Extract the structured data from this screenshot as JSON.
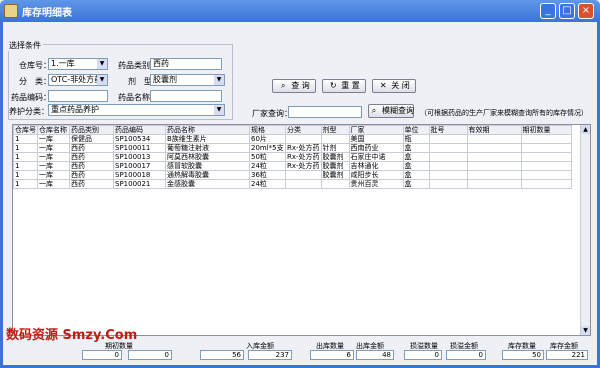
{
  "window": {
    "title": "库存明细表",
    "minimize": "_",
    "maximize": "□",
    "close": "×"
  },
  "filters": {
    "group_label": "选择条件",
    "warehouse_label": "仓库号：",
    "warehouse_value": "1.一库",
    "category_label": "药品类别：",
    "category_value": "西药",
    "type_label": "分　类：",
    "type_value": "OTC-非处方药",
    "form_label": "剂　型：",
    "form_value": "胶囊剂",
    "code_label": "药品编码：",
    "code_value": "",
    "name_label": "药品名称：",
    "name_value": "",
    "care_label": "养护分类：",
    "care_value": "重点药品养护"
  },
  "actions": {
    "query": "查 询",
    "reset": "重 置",
    "close": "关 闭"
  },
  "maker": {
    "label": "厂家查询：",
    "value": "",
    "button": "模糊查询",
    "hint": "（可根据药品的生产厂家来模糊查询所有的库存情况）"
  },
  "table": {
    "columns": [
      "仓库号",
      "仓库名称",
      "药品类别",
      "药品编码",
      "药品名称",
      "规格",
      "分类",
      "剂型",
      "厂家",
      "单位",
      "批号",
      "有效期",
      "期初数量"
    ],
    "rows": [
      [
        "1",
        "一库",
        "保健品",
        "SP100534",
        "B族维生素片",
        "60片",
        "",
        "",
        "美国",
        "瓶",
        "",
        "",
        ""
      ],
      [
        "1",
        "一库",
        "西药",
        "SP100011",
        "葡萄糖注射液",
        "20ml*5支",
        "Rx-处方药",
        "针剂",
        "西南药业",
        "盒",
        "",
        "",
        ""
      ],
      [
        "1",
        "一库",
        "西药",
        "SP100013",
        "阿莫西林胶囊",
        "50粒",
        "Rx-处方药",
        "胶囊剂",
        "石家庄中诺",
        "盒",
        "",
        "",
        ""
      ],
      [
        "1",
        "一库",
        "西药",
        "SP100017",
        "感冒软胶囊",
        "24粒",
        "Rx-处方药",
        "胶囊剂",
        "吉林通化",
        "盒",
        "",
        "",
        ""
      ],
      [
        "1",
        "一库",
        "西药",
        "SP100018",
        "通热解毒胶囊",
        "36粒",
        "",
        "胶囊剂",
        "咸阳步长",
        "盒",
        "",
        "",
        ""
      ],
      [
        "1",
        "一库",
        "西药",
        "SP100021",
        "金感胶囊",
        "24粒",
        "",
        "",
        "贵州百灵",
        "盒",
        "",
        "",
        ""
      ]
    ]
  },
  "totals": {
    "opening_qty_label": "期初数量",
    "opening_qty": "0",
    "opening_amt": "0",
    "in_qty": "56",
    "in_amt_label": "入库金额",
    "in_amt": "237",
    "out_qty_label": "出库数量",
    "out_qty": "6",
    "out_amt_label": "出库金额",
    "out_amt": "48",
    "loss_qty_label": "损溢数量",
    "loss_qty": "0",
    "loss_amt_label": "损溢金额",
    "loss_amt": "0",
    "stock_qty_label": "库存数量",
    "stock_qty": "50",
    "stock_amt_label": "库存金额",
    "stock_amt": "221"
  },
  "watermark": "数码资源 Smzy.Com"
}
